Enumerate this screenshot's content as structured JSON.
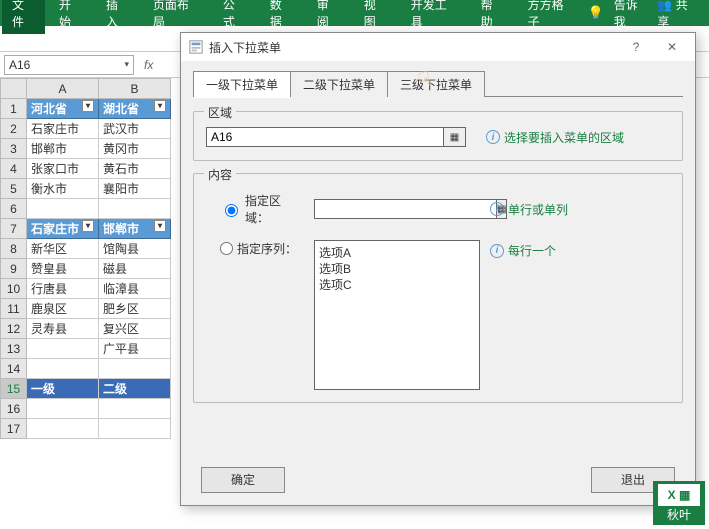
{
  "ribbon": {
    "file": "文件",
    "tabs": [
      "开始",
      "插入",
      "页面布局",
      "公式",
      "数据",
      "审阅",
      "视图",
      "开发工具",
      "帮助",
      "方方格子"
    ],
    "tellme": "告诉我",
    "share": "共享"
  },
  "namebox": {
    "value": "A16"
  },
  "columns": [
    "A",
    "B"
  ],
  "rows": [
    {
      "n": 1,
      "a": "河北省",
      "b": "湖北省",
      "cls": "hdr1",
      "filter": true
    },
    {
      "n": 2,
      "a": "石家庄市",
      "b": "武汉市"
    },
    {
      "n": 3,
      "a": "邯郸市",
      "b": "黄冈市"
    },
    {
      "n": 4,
      "a": "张家口市",
      "b": "黄石市"
    },
    {
      "n": 5,
      "a": "衡水市",
      "b": "襄阳市"
    },
    {
      "n": 6,
      "a": "",
      "b": ""
    },
    {
      "n": 7,
      "a": "石家庄市",
      "b": "邯郸市",
      "cls": "hdr2",
      "filter": true
    },
    {
      "n": 8,
      "a": "新华区",
      "b": "馆陶县"
    },
    {
      "n": 9,
      "a": "赞皇县",
      "b": "磁县"
    },
    {
      "n": 10,
      "a": "行唐县",
      "b": "临漳县"
    },
    {
      "n": 11,
      "a": "鹿泉区",
      "b": "肥乡区"
    },
    {
      "n": 12,
      "a": "灵寿县",
      "b": "复兴区"
    },
    {
      "n": 13,
      "a": "",
      "b": "广平县"
    },
    {
      "n": 14,
      "a": "",
      "b": ""
    },
    {
      "n": 15,
      "a": "一级",
      "b": "二级",
      "cls": "sel"
    },
    {
      "n": 16,
      "a": "",
      "b": ""
    },
    {
      "n": 17,
      "a": "",
      "b": ""
    }
  ],
  "dialog": {
    "title": "插入下拉菜单",
    "tabs": [
      "一级下拉菜单",
      "二级下拉菜单",
      "三级下拉菜单"
    ],
    "active_tab": 0,
    "region_group": "区域",
    "region_value": "A16",
    "region_hint": "选择要插入菜单的区域",
    "content_group": "内容",
    "radio_area": "指定区域：",
    "radio_area_hint": "单行或单列",
    "radio_series": "指定序列：",
    "radio_series_hint": "每行一个",
    "series_placeholder": "选项A\n选项B\n选项C",
    "ok": "确定",
    "exit": "退出"
  },
  "watermark": {
    "brand": "秋叶",
    "icon": "X ▦"
  },
  "chart_data": {
    "type": "table",
    "sheets": [
      {
        "header": [
          "河北省",
          "湖北省"
        ],
        "rows": [
          [
            "石家庄市",
            "武汉市"
          ],
          [
            "邯郸市",
            "黄冈市"
          ],
          [
            "张家口市",
            "黄石市"
          ],
          [
            "衡水市",
            "襄阳市"
          ]
        ]
      },
      {
        "header": [
          "石家庄市",
          "邯郸市"
        ],
        "rows": [
          [
            "新华区",
            "馆陶县"
          ],
          [
            "赞皇县",
            "磁县"
          ],
          [
            "行唐县",
            "临漳县"
          ],
          [
            "鹿泉区",
            "肥乡区"
          ],
          [
            "灵寿县",
            "复兴区"
          ],
          [
            "",
            "广平县"
          ]
        ]
      },
      {
        "header": [
          "一级",
          "二级"
        ],
        "rows": []
      }
    ]
  }
}
